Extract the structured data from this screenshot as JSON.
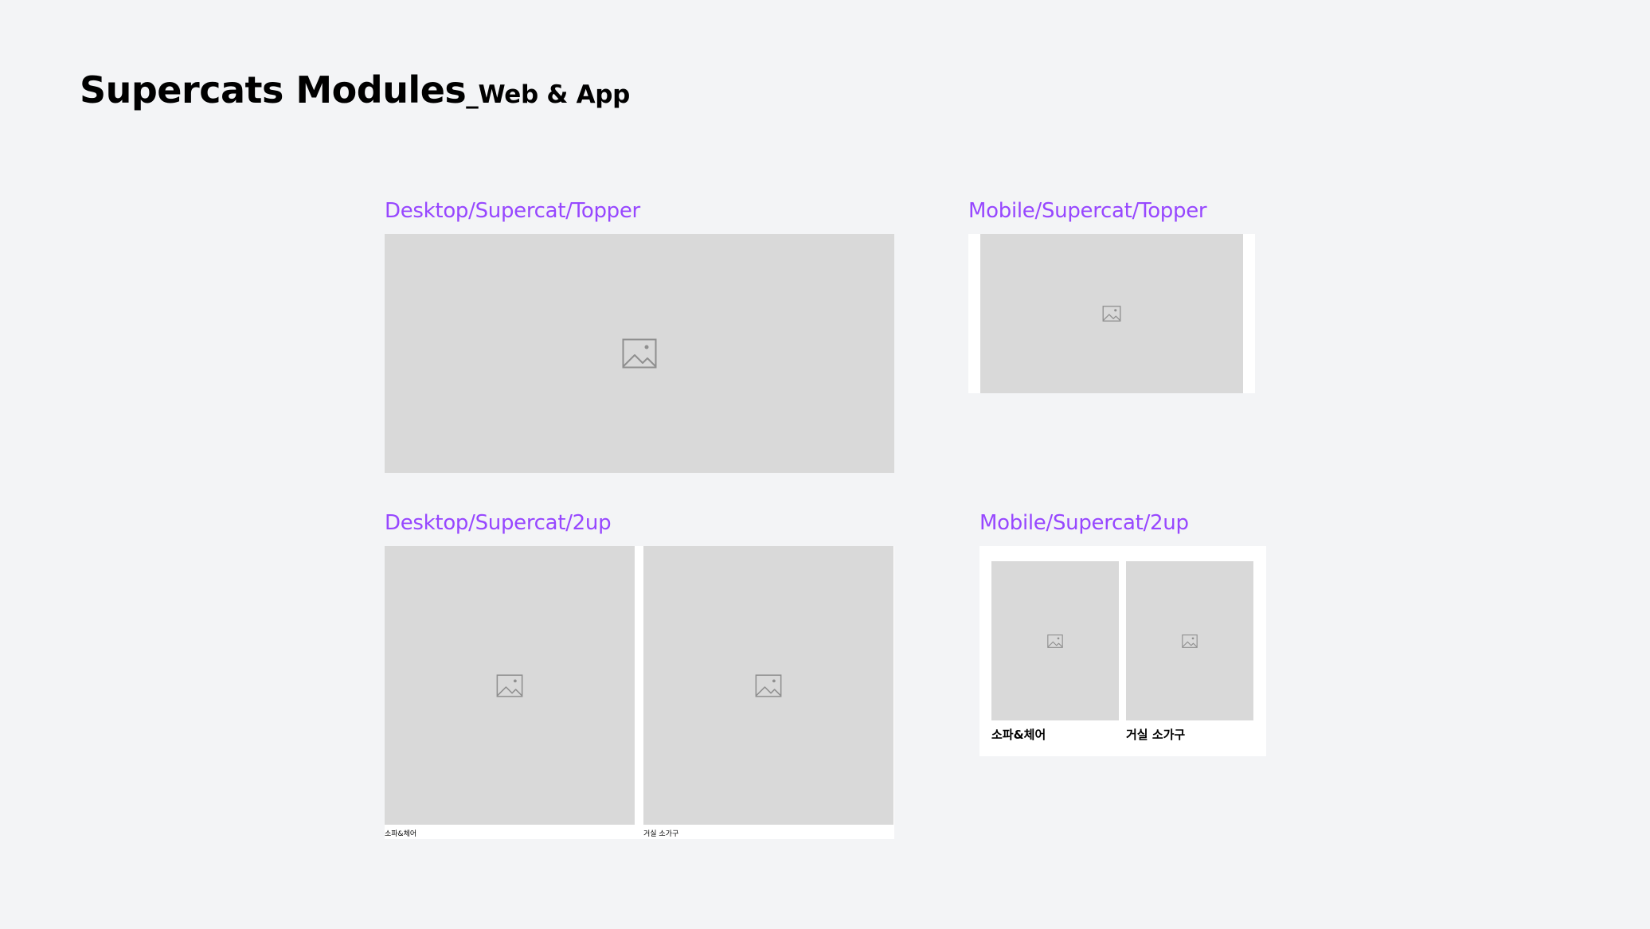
{
  "page": {
    "title_main": "Supercats Modules",
    "title_sub": "_Web & App"
  },
  "sections": {
    "desktop_topper": {
      "label": "Desktop/Supercat/Topper"
    },
    "mobile_topper": {
      "label": "Mobile/Supercat/Topper"
    },
    "desktop_2up": {
      "label": "Desktop/Supercat/2up",
      "items": [
        {
          "caption": "소파&체어"
        },
        {
          "caption": "거실 소가구"
        }
      ]
    },
    "mobile_2up": {
      "label": "Mobile/Supercat/2up",
      "items": [
        {
          "caption": "소파&체어"
        },
        {
          "caption": "거실 소가구"
        }
      ]
    }
  },
  "icons": {
    "placeholder": "image-placeholder-icon"
  },
  "colors": {
    "background": "#f3f4f6",
    "label_accent": "#9747ff",
    "placeholder_fill": "#d9d9d9",
    "icon_stroke": "#8f8f8f",
    "frame": "#ffffff"
  }
}
